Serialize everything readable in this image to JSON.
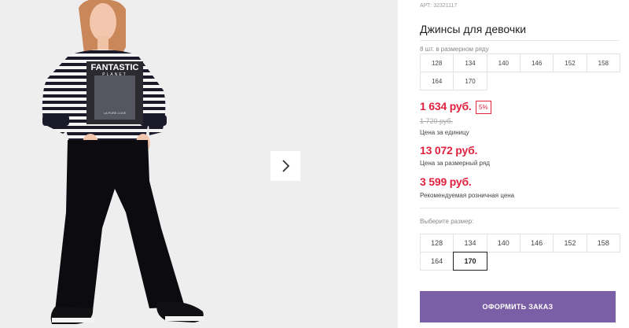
{
  "product": {
    "sku": "АРТ: 32321117",
    "title": "Джинсы для девочки",
    "print_text_main": "FANTASTIC",
    "print_text_sub": "PLANET",
    "print_text_small": "LA PURE LOVE"
  },
  "assortment": {
    "caption": "8 шт. в размерном ряду",
    "sizes": [
      "128",
      "134",
      "140",
      "146",
      "152",
      "158",
      "164",
      "170"
    ]
  },
  "pricing": {
    "unit_price": "1 634 руб.",
    "discount_badge": "5%",
    "old_price": "1 720 руб.",
    "unit_note": "Цена за единицу",
    "series_price": "13 072 руб.",
    "series_note": "Цена за размерный ряд",
    "retail_price": "3 599 руб.",
    "retail_note": "Рекомендуемая розничная цена"
  },
  "size_picker": {
    "caption": "Выберите размер:",
    "sizes": [
      "128",
      "134",
      "140",
      "146",
      "152",
      "158",
      "164",
      "170"
    ],
    "selected": "170"
  },
  "actions": {
    "order_label": "ОФОРМИТЬ ЗАКАЗ"
  },
  "colors": {
    "price_red": "#e0223e",
    "button_purple": "#7b5fa6"
  }
}
